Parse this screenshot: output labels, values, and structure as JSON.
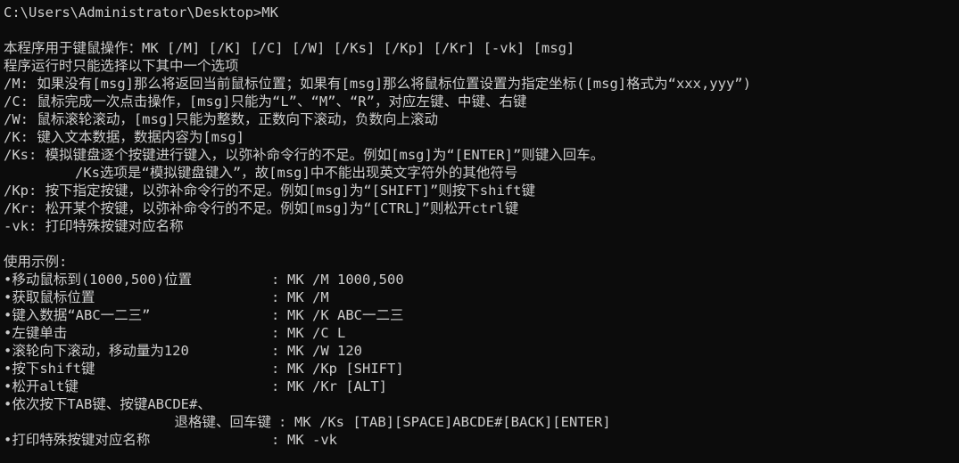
{
  "prompt": "C:\\Users\\Administrator\\Desktop>MK",
  "usage": "本程序用于键鼠操作：MK [/M] [/K] [/C] [/W] [/Ks] [/Kp] [/Kr] [-vk] [msg]",
  "option_note": "程序运行时只能选择以下其中一个选项",
  "options": {
    "m": "/M: 如果没有[msg]那么将返回当前鼠标位置；如果有[msg]那么将鼠标位置设置为指定坐标([msg]格式为“xxx,yyy”)",
    "c": "/C: 鼠标完成一次点击操作，[msg]只能为“L”、“M”、“R”，对应左键、中键、右键",
    "w": "/W: 鼠标滚轮滚动，[msg]只能为整数，正数向下滚动，负数向上滚动",
    "k": "/K: 键入文本数据，数据内容为[msg]",
    "ks": "/Ks: 模拟键盘逐个按键进行键入，以弥补命令行的不足。例如[msg]为“[ENTER]”则键入回车。",
    "ks_note": "/Ks选项是“模拟键盘键入”，故[msg]中不能出现英文字符外的其他符号",
    "kp": "/Kp: 按下指定按键，以弥补命令行的不足。例如[msg]为“[SHIFT]”则按下shift键",
    "kr": "/Kr: 松开某个按键，以弥补命令行的不足。例如[msg]为“[CTRL]”则松开ctrl键",
    "vk": "-vk: 打印特殊按键对应名称"
  },
  "examples_title": "使用示例:",
  "examples": [
    {
      "desc": "•移动鼠标到(1000,500)位置",
      "sep": ":",
      "cmd": "MK /M 1000,500"
    },
    {
      "desc": "•获取鼠标位置",
      "sep": ":",
      "cmd": "MK /M"
    },
    {
      "desc": "•键入数据“ABC一二三”",
      "sep": ":",
      "cmd": "MK /K ABC一二三"
    },
    {
      "desc": "•左键单击",
      "sep": ":",
      "cmd": "MK /C L"
    },
    {
      "desc": "•滚轮向下滚动，移动量为120",
      "sep": ":",
      "cmd": "MK /W 120"
    },
    {
      "desc": "•按下shift键",
      "sep": ":",
      "cmd": "MK /Kp [SHIFT]"
    },
    {
      "desc": "•松开alt键",
      "sep": ":",
      "cmd": "MK /Kr [ALT]"
    }
  ],
  "example_multi": {
    "desc_line1": "•依次按下TAB键、按键ABCDE#、",
    "desc_line2": "退格键、回车键",
    "sep": ":",
    "cmd": "MK /Ks [TAB][SPACE]ABCDE#[BACK][ENTER]"
  },
  "example_last": {
    "desc": "•打印特殊按键对应名称",
    "sep": ":",
    "cmd": "MK -vk"
  },
  "colors": {
    "background": "#0c0c0c",
    "text": "#cccccc"
  }
}
